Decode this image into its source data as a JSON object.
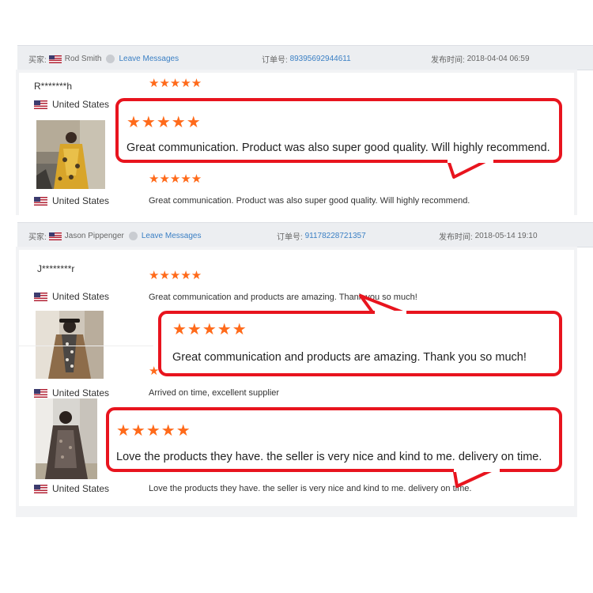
{
  "orders": [
    {
      "buyer_label": "买家:",
      "buyer_name": "Rod Smith",
      "leave_messages": "Leave Messages",
      "order_label": "订单号:",
      "order_number": "89395692944611",
      "time_label": "发布时间:",
      "time_value": "2018-04-04 06:59",
      "reviewer_masked": "R*******h",
      "reviews": [
        {
          "stars": "★★★★★",
          "country": "United States",
          "text": "Great communication. Product was also super good quality. Will highly recommend."
        }
      ],
      "callout": {
        "stars": "★★★★★",
        "text": "Great communication. Product was also super good quality. Will highly recommend."
      }
    },
    {
      "buyer_label": "买家:",
      "buyer_name": "Jason Pippenger",
      "leave_messages": "Leave Messages",
      "order_label": "订单号:",
      "order_number": "91178228721357",
      "time_label": "发布时间:",
      "time_value": "2018-05-14 19:10",
      "reviewer_masked": "J********r",
      "reviews": [
        {
          "stars": "★★★★★",
          "country": "United States",
          "text": "Great communication and products are amazing. Thank you so much!"
        },
        {
          "stars": "★",
          "country": "United States",
          "text": "Arrived on time, excellent supplier"
        },
        {
          "country": "United States",
          "text": "Love the products they have. the seller is very nice and kind to me. delivery on time."
        }
      ],
      "callouts": [
        {
          "stars": "★★★★★",
          "text": "Great communication and products are amazing. Thank you so much!"
        },
        {
          "stars": "★★★★★",
          "text": "Love the products they have. the seller is very nice and kind to me. delivery on time."
        }
      ]
    }
  ],
  "colors": {
    "star": "#ff6a1a",
    "callout_border": "#e8141e",
    "link": "#3a7fc4"
  },
  "icons": {
    "flag": "us-flag-icon",
    "message": "message-icon",
    "star": "star-icon"
  }
}
